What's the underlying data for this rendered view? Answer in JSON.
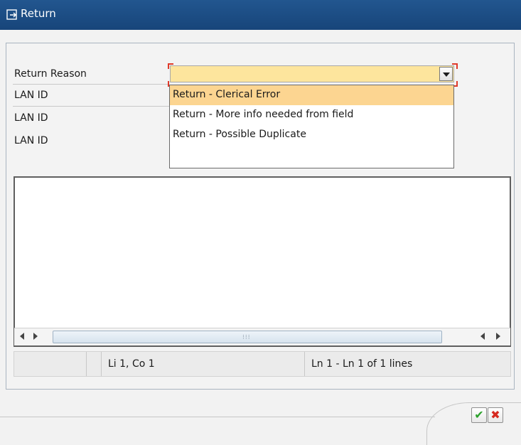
{
  "window": {
    "title": "Return"
  },
  "form": {
    "return_reason_label": "Return Reason",
    "lan_id_label_1": "LAN ID",
    "lan_id_label_2": "LAN ID",
    "lan_id_label_3": "LAN ID",
    "return_reason_value": ""
  },
  "dropdown": {
    "options": [
      "Return - Clerical Error",
      "Return - More info needed from field",
      "Return - Possible Duplicate"
    ],
    "selected_index": 0
  },
  "text_editor": {
    "content": ""
  },
  "status": {
    "cursor": "Li 1, Co 1",
    "lines": "Ln 1 - Ln 1 of 1 lines"
  },
  "colors": {
    "titlebar": "#1b4f8a",
    "combo_fill": "#fde59d",
    "selected_option": "#fcd591",
    "required_marker": "#e03a2a",
    "ok_check": "#2aa12a",
    "cancel_x": "#d6291f"
  },
  "icons": {
    "title": "dialog-icon",
    "dropdown": "chevron-down-icon",
    "scroll_left": "arrow-left-icon",
    "scroll_right": "arrow-right-icon",
    "ok": "checkmark-icon",
    "cancel": "close-icon"
  }
}
